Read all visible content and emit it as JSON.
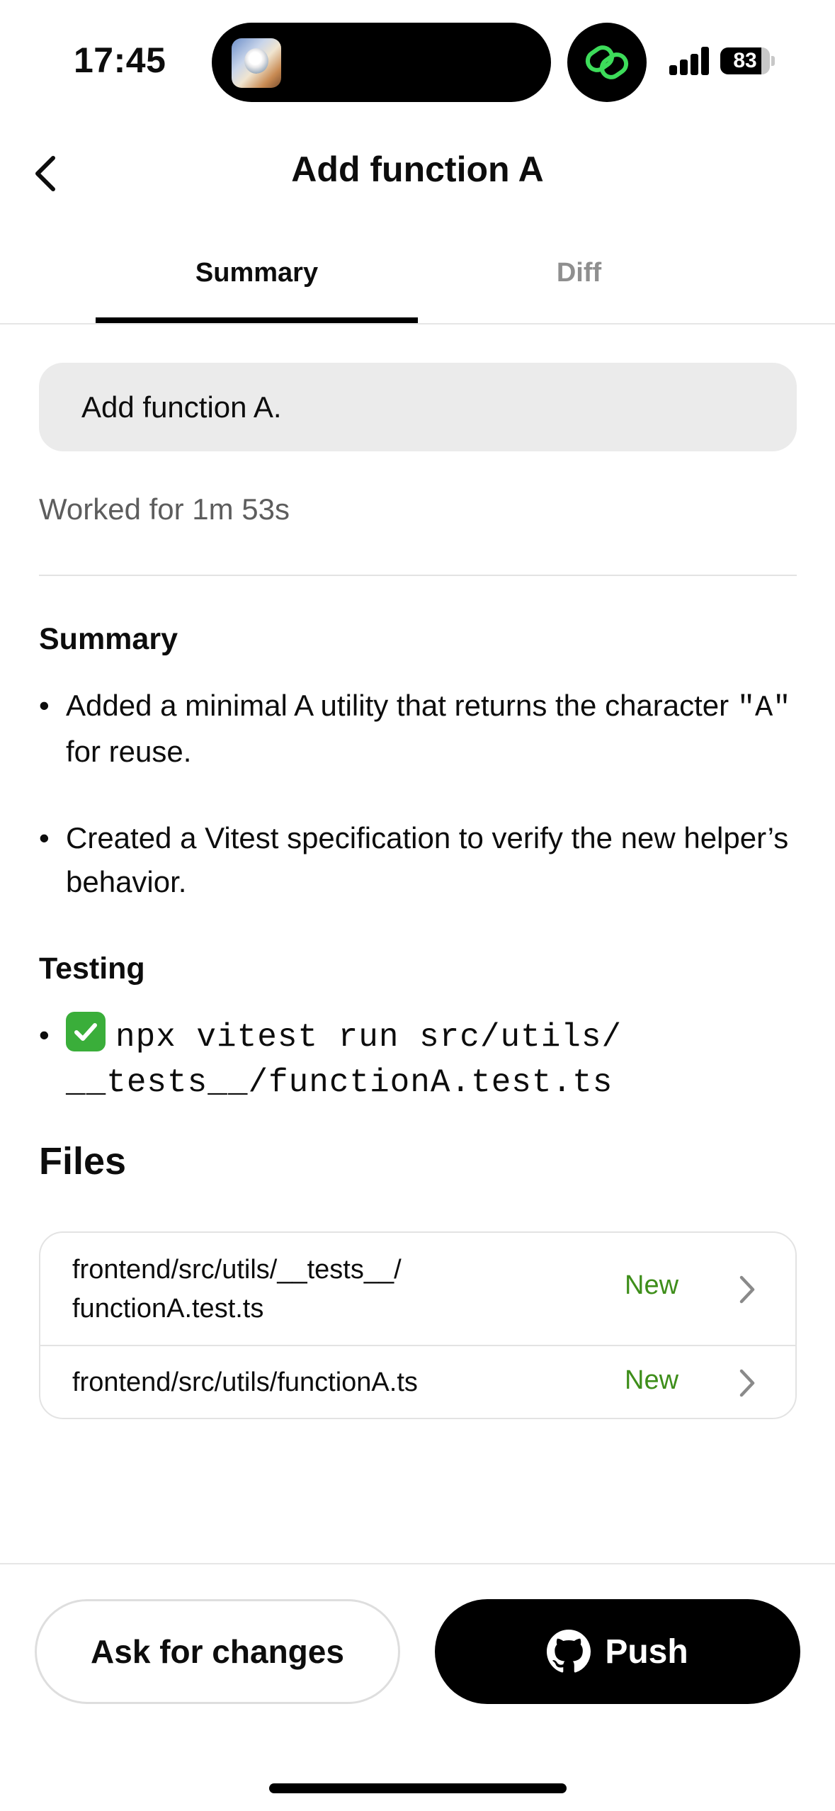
{
  "status_bar": {
    "time": "17:45",
    "battery_percent": "83",
    "battery_level": 0.83,
    "signal_bars": 4
  },
  "header": {
    "back_icon": "chevron-left-icon",
    "title": "Add function A"
  },
  "tabs": [
    {
      "label": "Summary",
      "active": true
    },
    {
      "label": "Diff",
      "active": false
    }
  ],
  "prompt": "Add function A.",
  "worked_for": "Worked for 1m 53s",
  "summary": {
    "heading": "Summary",
    "bullets": [
      {
        "before": "Added a minimal A utility that returns the character ",
        "code": "\"A\"",
        "after": " for reuse."
      },
      {
        "text": "Created a Vitest specification to verify the new helper’s behavior."
      }
    ]
  },
  "testing": {
    "heading": "Testing",
    "status_icon": "check-mark-icon",
    "command_line1": "npx vitest run src/utils/",
    "command_line2": "__tests__/functionA.test.ts"
  },
  "files": {
    "title": "Files",
    "items": [
      {
        "path_line1": "frontend/src/utils/__tests__/",
        "path_line2": "functionA.test.ts",
        "status": "New"
      },
      {
        "path_line1": "frontend/src/utils/functionA.ts",
        "path_line2": "",
        "status": "New"
      }
    ]
  },
  "actions": {
    "ask_label": "Ask for changes",
    "push_label": "Push",
    "push_icon": "github-icon"
  },
  "colors": {
    "accent_new": "#3e8e1a",
    "bubble_bg": "#ebebeb",
    "check_green": "#3aae3a"
  }
}
